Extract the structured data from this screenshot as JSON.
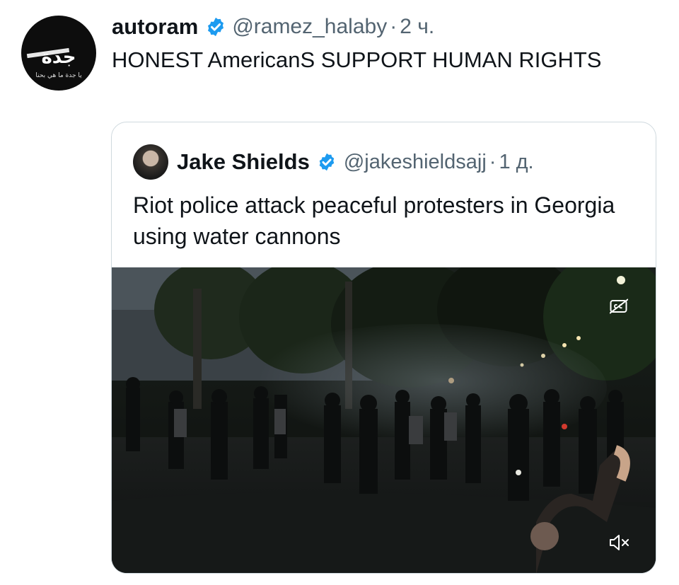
{
  "tweet": {
    "author_name": "autoram",
    "author_handle": "@ramez_halaby",
    "separator": "·",
    "time": "2 ч.",
    "text": "HONEST AmericanS SUPPORT HUMAN RIGHTS",
    "avatar_logo_text": "جدة",
    "avatar_logo_subtext": "يا جدة ما هي بحنا",
    "verified_icon": "verified-badge-icon",
    "verified_color": "#1d9bf0"
  },
  "quoted_tweet": {
    "author_name": "Jake Shields",
    "author_handle": "@jakeshieldsajj",
    "separator": "·",
    "time": "1 д.",
    "text": "Riot police attack peaceful protesters in Georgia using water cannons",
    "verified_icon": "verified-badge-icon",
    "media": {
      "type": "video",
      "captions_icon": "closed-captions-icon",
      "mute_icon": "speaker-muted-icon"
    }
  },
  "colors": {
    "text_primary": "#0f1419",
    "text_secondary": "#536471",
    "border": "#cfd9de",
    "verified": "#1d9bf0"
  }
}
